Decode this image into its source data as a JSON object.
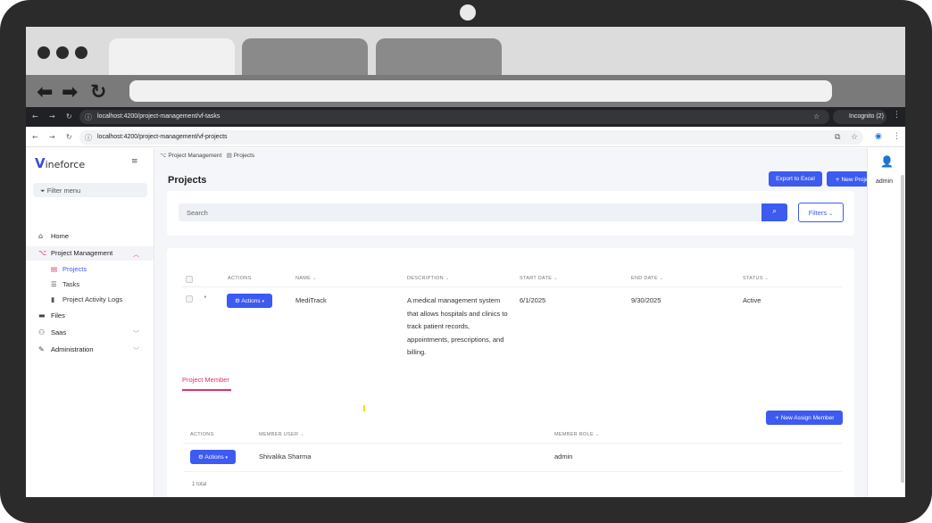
{
  "browser": {
    "dark_bar": {
      "url": "localhost:4200/project-management/vf-tasks",
      "incognito_label": "Incognito (2)"
    },
    "light_bar": {
      "url": "localhost:4200/project-management/vf-projects"
    }
  },
  "sidebar": {
    "logo_v": "V",
    "logo_rest": "ineforce",
    "filter_placeholder": "Filter menu",
    "items": [
      {
        "label": "Home",
        "icon": "home-icon"
      },
      {
        "label": "Project Management",
        "icon": "sitemap-icon",
        "expanded": true,
        "children": [
          {
            "label": "Projects",
            "icon": "table-icon",
            "active": true
          },
          {
            "label": "Tasks",
            "icon": "list-icon"
          },
          {
            "label": "Project Activity Logs",
            "icon": "file-icon"
          }
        ]
      },
      {
        "label": "Files",
        "icon": "folder-icon"
      },
      {
        "label": "Saas",
        "icon": "users-icon"
      },
      {
        "label": "Administration",
        "icon": "wrench-icon"
      }
    ]
  },
  "breadcrumb": {
    "items": [
      "Project Management",
      "Projects"
    ]
  },
  "page": {
    "title": "Projects",
    "export_label": "Export to Excel",
    "new_project_label": "New Project"
  },
  "search": {
    "placeholder": "Search",
    "filters_label": "Filters"
  },
  "table": {
    "columns": [
      "ACTIONS",
      "NAME",
      "DESCRIPTION",
      "START DATE",
      "END DATE",
      "STATUS"
    ],
    "rows": [
      {
        "actions_label": "Actions",
        "name": "MediTrack",
        "description": "A medical management system that allows hospitals and clinics to track patient records, appointments, prescriptions, and billing.",
        "start_date": "6/1/2025",
        "end_date": "9/30/2025",
        "status": "Active"
      }
    ]
  },
  "member_panel": {
    "tab_label": "Project Member",
    "new_assign_label": "New Assign Member",
    "columns": [
      "ACTIONS",
      "MEMBER USER",
      "MEMBER ROLE"
    ],
    "rows": [
      {
        "actions_label": "Actions",
        "member_user": "Shivalika Sharma",
        "member_role": "admin"
      }
    ],
    "total_text": "1 total"
  },
  "user": {
    "name": "admin"
  },
  "colors": {
    "primary": "#3d5af1",
    "accent": "#e0316d"
  }
}
